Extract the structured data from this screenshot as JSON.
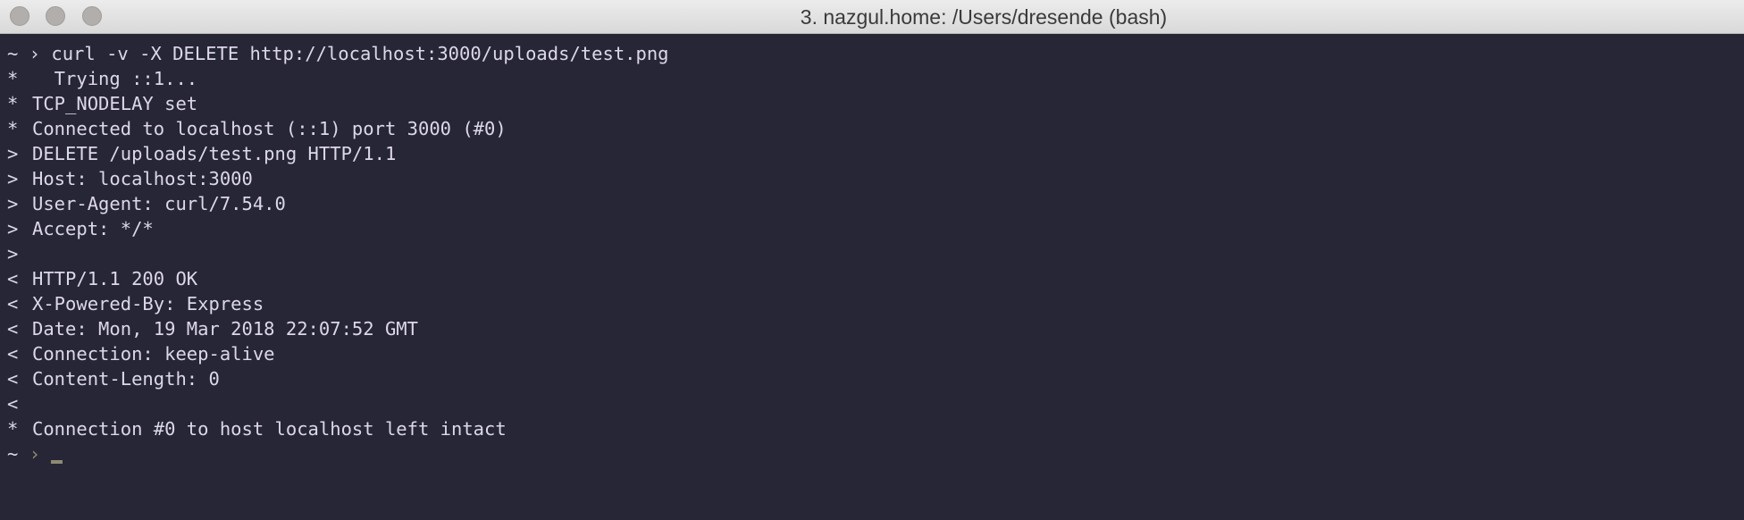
{
  "window": {
    "title": "3. nazgul.home: /Users/dresende (bash)"
  },
  "colors": {
    "background": "#272636",
    "text": "#dcd8ea",
    "titlebar": "#e3e3e3",
    "prompt_muted": "#8f8c70"
  },
  "terminal": {
    "lines": [
      {
        "prefix": "~ ›",
        "text": " curl -v -X DELETE http://localhost:3000/uploads/test.png"
      },
      {
        "prefix": "*",
        "text": "  Trying ::1..."
      },
      {
        "prefix": "*",
        "text": "TCP_NODELAY set"
      },
      {
        "prefix": "*",
        "text": "Connected to localhost (::1) port 3000 (#0)"
      },
      {
        "prefix": ">",
        "text": "DELETE /uploads/test.png HTTP/1.1"
      },
      {
        "prefix": ">",
        "text": "Host: localhost:3000"
      },
      {
        "prefix": ">",
        "text": "User-Agent: curl/7.54.0"
      },
      {
        "prefix": ">",
        "text": "Accept: */*"
      },
      {
        "prefix": ">",
        "text": ""
      },
      {
        "prefix": "<",
        "text": "HTTP/1.1 200 OK"
      },
      {
        "prefix": "<",
        "text": "X-Powered-By: Express"
      },
      {
        "prefix": "<",
        "text": "Date: Mon, 19 Mar 2018 22:07:52 GMT"
      },
      {
        "prefix": "<",
        "text": "Connection: keep-alive"
      },
      {
        "prefix": "<",
        "text": "Content-Length: 0"
      },
      {
        "prefix": "<",
        "text": ""
      },
      {
        "prefix": "*",
        "text": "Connection #0 to host localhost left intact"
      }
    ],
    "prompt": {
      "tilde": "~",
      "arrow": "›"
    }
  }
}
